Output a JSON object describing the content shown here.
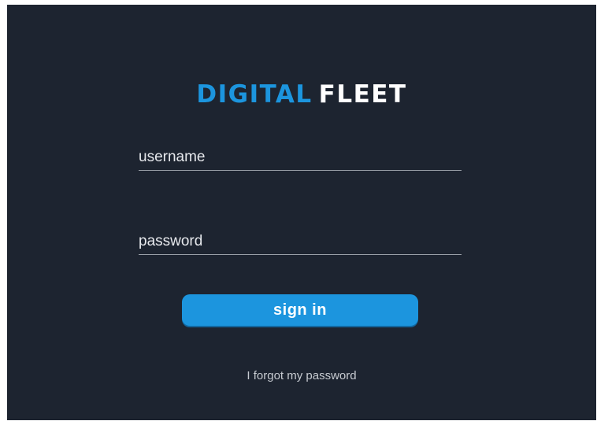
{
  "logo": {
    "part1": "DIGITAL",
    "part2": "FLEET",
    "part1_color": "#1c95de",
    "part2_color": "#ffffff"
  },
  "form": {
    "username_placeholder": "username",
    "password_placeholder": "password",
    "signin_label": "sign in",
    "forgot_label": "I forgot my password"
  },
  "colors": {
    "background": "#1d2430",
    "accent": "#1c95de"
  }
}
